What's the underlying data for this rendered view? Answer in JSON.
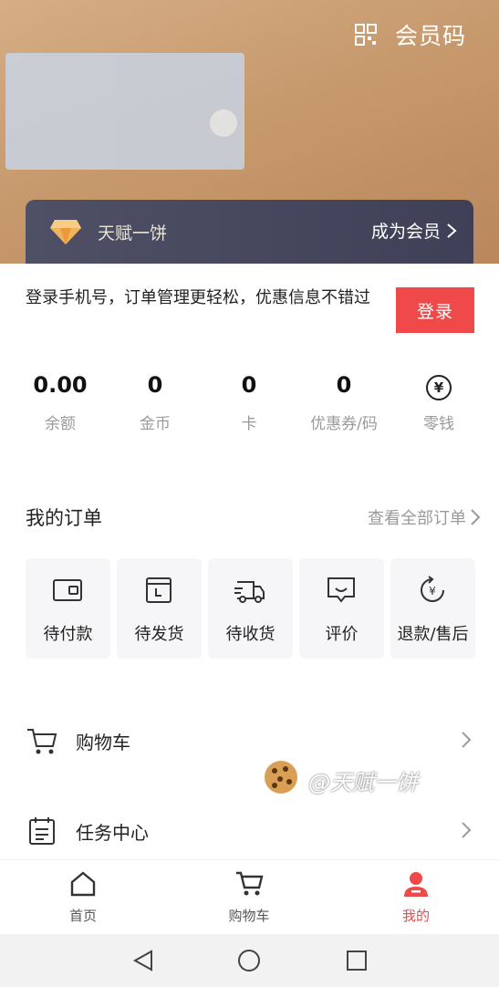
{
  "header": {
    "member_code": "会员码"
  },
  "vip": {
    "name": "天赋一饼",
    "join_label": "成为会员"
  },
  "login": {
    "prompt": "登录手机号，订单管理更轻松，优惠信息不错过",
    "button": "登录"
  },
  "assets": [
    {
      "value": "0.00",
      "label": "余额"
    },
    {
      "value": "0",
      "label": "金币"
    },
    {
      "value": "0",
      "label": "卡"
    },
    {
      "value": "0",
      "label": "优惠券/码"
    },
    {
      "value": "¥",
      "label": "零钱"
    }
  ],
  "orders": {
    "title": "我的订单",
    "view_all": "查看全部订单",
    "items": [
      {
        "label": "待付款",
        "icon": "wallet-icon"
      },
      {
        "label": "待发货",
        "icon": "package-icon"
      },
      {
        "label": "待收货",
        "icon": "truck-icon"
      },
      {
        "label": "评价",
        "icon": "comment-icon"
      },
      {
        "label": "退款/售后",
        "icon": "refund-icon"
      }
    ]
  },
  "menu": [
    {
      "label": "购物车",
      "icon": "cart-icon"
    },
    {
      "label": "任务中心",
      "icon": "task-icon"
    }
  ],
  "watermark": "@天赋一饼",
  "tabbar": [
    {
      "label": "首页",
      "icon": "home-icon"
    },
    {
      "label": "购物车",
      "icon": "cart-icon"
    },
    {
      "label": "我的",
      "icon": "profile-icon",
      "active": true
    }
  ],
  "colors": {
    "accent": "#ef4a49",
    "header_gold": "#c79a6e",
    "vip_bar": "#474860"
  }
}
